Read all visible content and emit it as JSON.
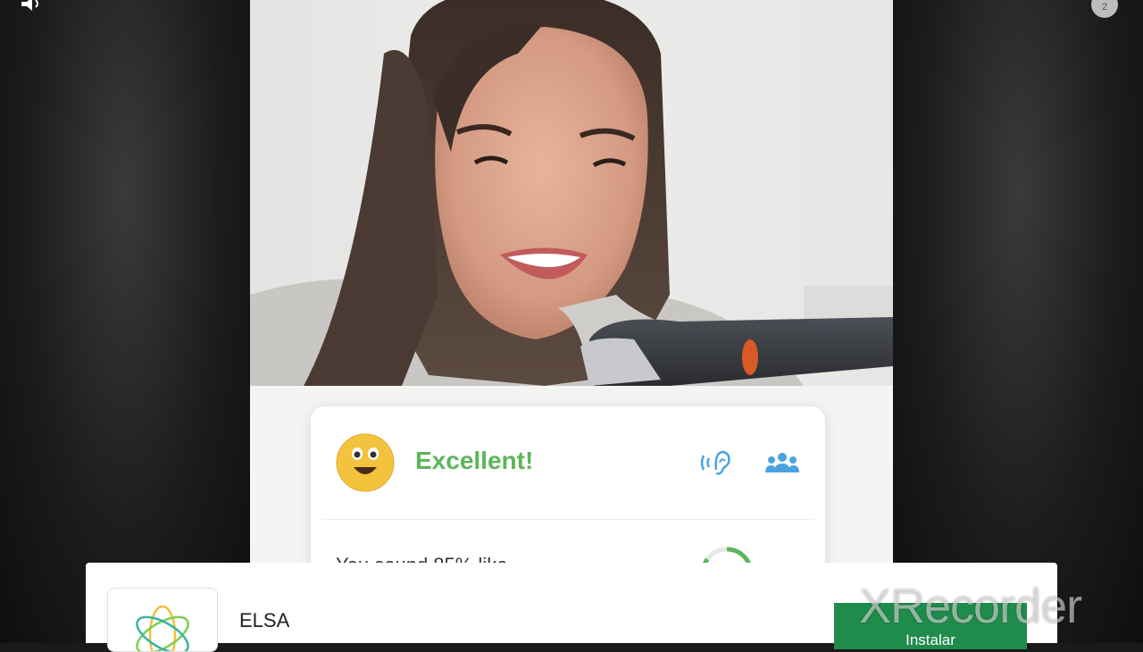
{
  "overlay": {
    "badge_count": "2",
    "watermark": "XRecorder"
  },
  "result_card": {
    "label": "Excellent!",
    "score_text": "You sound 85% like",
    "colors": {
      "accent": "#5cb65a",
      "icons": "#4aa3df"
    },
    "icons": [
      "smiling-face-icon",
      "ear-sound-icon",
      "group-icon",
      "progress-ring-icon"
    ]
  },
  "ad": {
    "app_name": "ELSA",
    "install_label": "Instalar",
    "logo_icon": "elsa-logo-icon",
    "colors": {
      "button": "#1f8c4b"
    }
  }
}
